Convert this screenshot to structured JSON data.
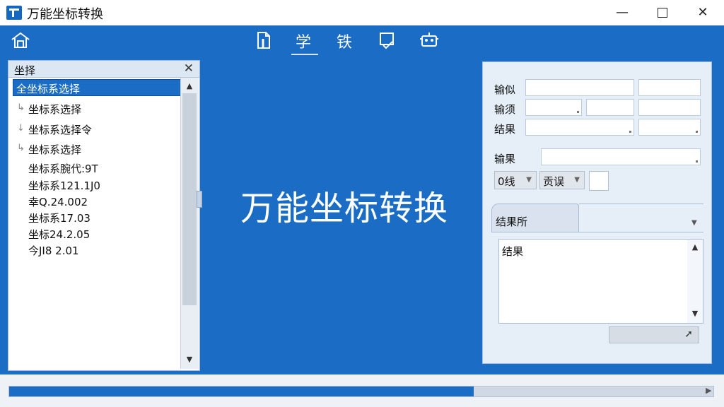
{
  "window": {
    "title": "万能坐标转换",
    "minimize_glyph": "—",
    "close_glyph": "✕"
  },
  "toolbar": {
    "text_icon_1": "学",
    "text_icon_2": "铁"
  },
  "left_panel": {
    "title": "坐择",
    "close_glyph": "✕",
    "items": [
      {
        "label": "全坐标系选择",
        "twig": ""
      },
      {
        "label": "坐标系选择",
        "twig": "↳"
      },
      {
        "label": "坐标系选择令",
        "twig": "↓"
      },
      {
        "label": "坐标系选择",
        "twig": "↳"
      },
      {
        "label": "坐标系腕代:9T",
        "twig": ""
      },
      {
        "label": "坐标系121.1J0",
        "twig": ""
      },
      {
        "label": "幸Q.24.002",
        "twig": ""
      },
      {
        "label": "坐标系17.03",
        "twig": ""
      },
      {
        "label": "坐标24.2.05",
        "twig": ""
      },
      {
        "label": "今JI8 2.01",
        "twig": ""
      }
    ],
    "scroll_up": "▲",
    "scroll_down": "▼"
  },
  "center_title": "万能坐标转换",
  "right_panel": {
    "input_label": "输似",
    "source_label": "输须",
    "result_label": "结果",
    "output_label": "输果",
    "select_1": "0线",
    "select_2": "贡误",
    "select_caret": "▼",
    "tab_label": "结果所",
    "tab_dropdown": "▼",
    "result_box_label": "结果",
    "scroll_up": "▲",
    "scroll_down": "▼",
    "send_icon": "➚"
  },
  "status": {
    "progress": 0.66,
    "arrow": "▶"
  }
}
